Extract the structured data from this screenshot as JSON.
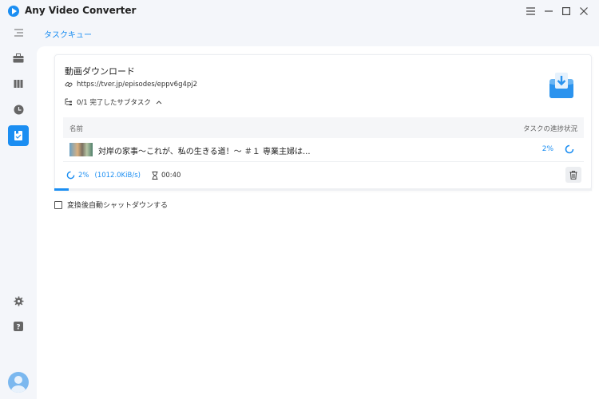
{
  "app": {
    "title": "Any Video Converter"
  },
  "tabs": {
    "queue": "タスクキュー"
  },
  "task": {
    "card_title": "動画ダウンロード",
    "url": "https://tver.jp/episodes/eppv6g4pj2",
    "subtasks": "0/1 完了したサブタスク"
  },
  "table": {
    "col_name": "名前",
    "col_progress": "タスクの進捗状況",
    "rows": [
      {
        "name": "対岸の家事～これが、私の生きる道！～ ＃１ 専業主婦は...",
        "progress": "2%"
      }
    ]
  },
  "stats": {
    "percent": "2%",
    "speed": "(1012.0KiB/s)",
    "elapsed": "00:40"
  },
  "progress_value": 0.02,
  "options": {
    "shutdown_label": "変換後自動シャットダウンする",
    "shutdown_checked": false
  },
  "colors": {
    "accent": "#1b8ef2"
  }
}
